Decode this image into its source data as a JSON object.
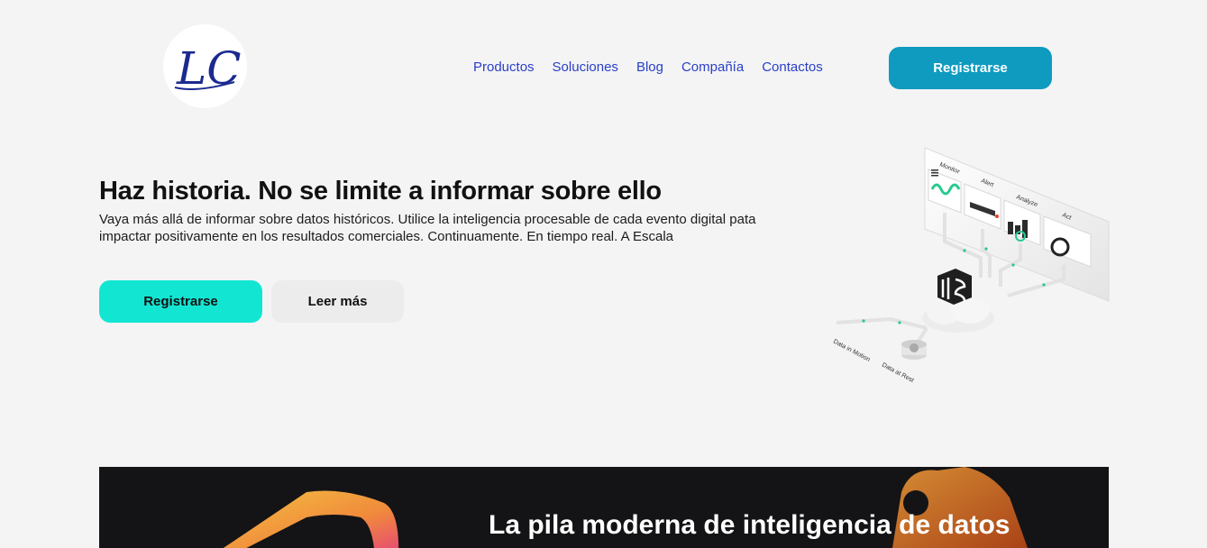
{
  "header": {
    "logo_text": "LC",
    "nav": [
      {
        "label": "Productos"
      },
      {
        "label": "Soluciones"
      },
      {
        "label": "Blog"
      },
      {
        "label": "Compañía"
      },
      {
        "label": "Contactos"
      }
    ],
    "cta_label": "Registrarse"
  },
  "hero": {
    "title": "Haz historia. No se limite a informar sobre ello",
    "subtitle": "Vaya más allá de informar sobre datos históricos. Utilice la inteligencia procesable de cada evento digital pata impactar positivamente en los resultados comerciales. Continuamente. En tiempo real. A Escala",
    "primary_label": "Registrarse",
    "secondary_label": "Leer más"
  },
  "illustration": {
    "panel_labels": [
      "Monitor",
      "Alert",
      "Analyze",
      "Act"
    ],
    "motion_label": "Data in Motion",
    "rest_label": "Data at Rest"
  },
  "section2": {
    "title": "La pila moderna de inteligencia de datos"
  },
  "colors": {
    "nav_link": "#2a3fc7",
    "header_button": "#0e9bbf",
    "primary_button": "#12e6d3",
    "dark_section": "#141416"
  }
}
